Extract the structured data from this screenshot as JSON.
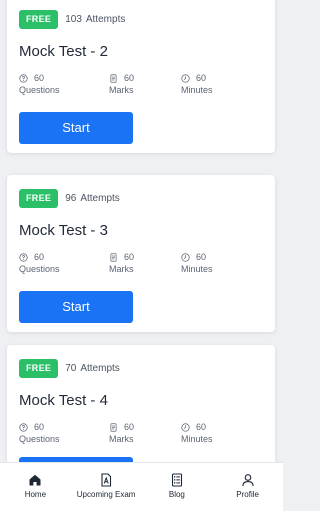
{
  "cards": [
    {
      "badge": "FREE",
      "attempts_count": "103",
      "attempts_label": "Attempts",
      "title": "Mock Test - 2",
      "questions_value": "60",
      "questions_label": "Questions",
      "marks_value": "60",
      "marks_label": "Marks",
      "minutes_value": "60",
      "minutes_label": "Minutes",
      "button_label": "Start"
    },
    {
      "badge": "FREE",
      "attempts_count": "96",
      "attempts_label": "Attempts",
      "title": "Mock Test - 3",
      "questions_value": "60",
      "questions_label": "Questions",
      "marks_value": "60",
      "marks_label": "Marks",
      "minutes_value": "60",
      "minutes_label": "Minutes",
      "button_label": "Start"
    },
    {
      "badge": "FREE",
      "attempts_count": "70",
      "attempts_label": "Attempts",
      "title": "Mock Test - 4",
      "questions_value": "60",
      "questions_label": "Questions",
      "marks_value": "60",
      "marks_label": "Marks",
      "minutes_value": "60",
      "minutes_label": "Minutes"
    }
  ],
  "nav": {
    "items": [
      {
        "label": "Home",
        "icon": "home-icon"
      },
      {
        "label": "Upcoming Exam",
        "icon": "exam-document-icon"
      },
      {
        "label": "Blog",
        "icon": "blog-list-icon"
      },
      {
        "label": "Profile",
        "icon": "profile-icon"
      }
    ]
  },
  "colors": {
    "badge_green": "#2bbf68",
    "button_blue": "#1a73f5",
    "background": "#eef0f3"
  }
}
